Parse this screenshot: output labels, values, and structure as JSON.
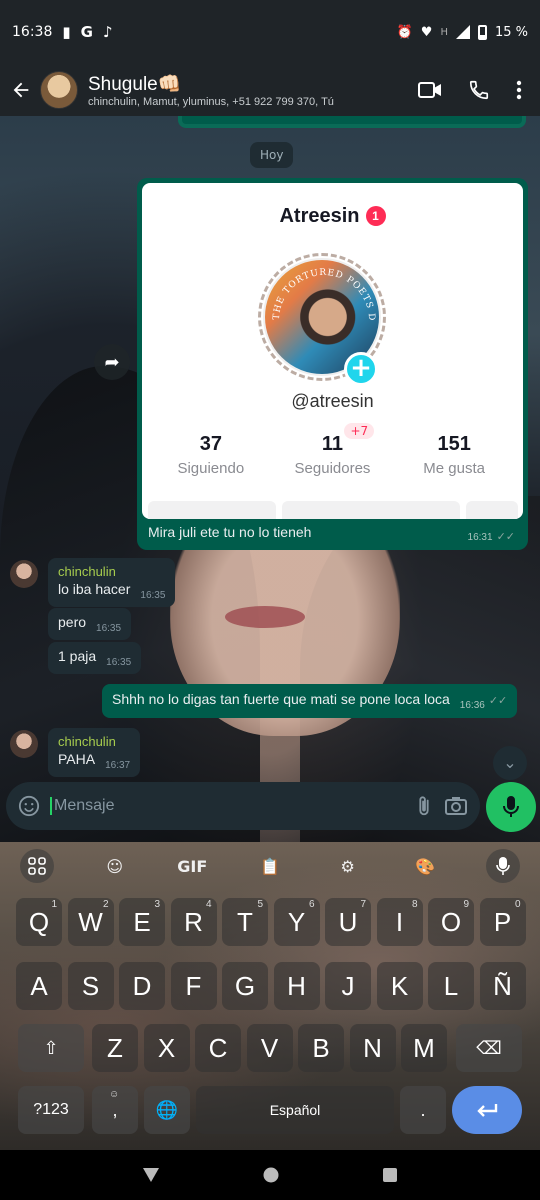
{
  "status_bar": {
    "time": "16:38",
    "left_icons": [
      "alert-icon",
      "google-icon",
      "tiktok-icon"
    ],
    "network": "H",
    "battery": "15 %"
  },
  "header": {
    "title": "Shugule👊🏻",
    "subtitle": "chinchulin, Mamut, yluminus, +51 922 799 370, Tú"
  },
  "chat": {
    "date_chip": "Hoy",
    "forwarded_card": {
      "username": "Atreesin",
      "badge": "1",
      "handle": "@atreesin",
      "avatar_text": "THE TORTURED POETS DEPARTMENT",
      "stats": [
        {
          "value": "37",
          "label": "Siguiendo"
        },
        {
          "value": "11",
          "label": "Seguidores",
          "delta": "+7"
        },
        {
          "value": "151",
          "label": "Me gusta"
        }
      ],
      "caption": "Mira juli ete tu no lo tieneh",
      "time": "16:31"
    },
    "messages": [
      {
        "sender": "chinchulin",
        "text": "lo iba hacer",
        "time": "16:35"
      },
      {
        "text": "pero",
        "time": "16:35"
      },
      {
        "text": "1 paja",
        "time": "16:35"
      },
      {
        "out": true,
        "text": "Shhh no lo digas tan fuerte que mati se pone loca loca",
        "time": "16:36"
      },
      {
        "sender": "chinchulin",
        "text": "PAHA",
        "time": "16:37"
      }
    ]
  },
  "composer": {
    "placeholder": "Mensaje"
  },
  "keyboard": {
    "toolbar": [
      "apps-icon",
      "sticker-icon",
      "GIF",
      "clipboard-icon",
      "settings-icon",
      "palette-icon",
      "mic-icon"
    ],
    "gif_label": "GIF",
    "row1": [
      {
        "k": "Q",
        "h": "1"
      },
      {
        "k": "W",
        "h": "2"
      },
      {
        "k": "E",
        "h": "3"
      },
      {
        "k": "R",
        "h": "4"
      },
      {
        "k": "T",
        "h": "5"
      },
      {
        "k": "Y",
        "h": "6"
      },
      {
        "k": "U",
        "h": "7"
      },
      {
        "k": "I",
        "h": "8"
      },
      {
        "k": "O",
        "h": "9"
      },
      {
        "k": "P",
        "h": "0"
      }
    ],
    "row2": [
      "A",
      "S",
      "D",
      "F",
      "G",
      "H",
      "J",
      "K",
      "L",
      "Ñ"
    ],
    "row3": [
      "Z",
      "X",
      "C",
      "V",
      "B",
      "N",
      "M"
    ],
    "symbols_label": "?123",
    "comma_label": ",",
    "space_label": "Español",
    "period_label": "."
  }
}
